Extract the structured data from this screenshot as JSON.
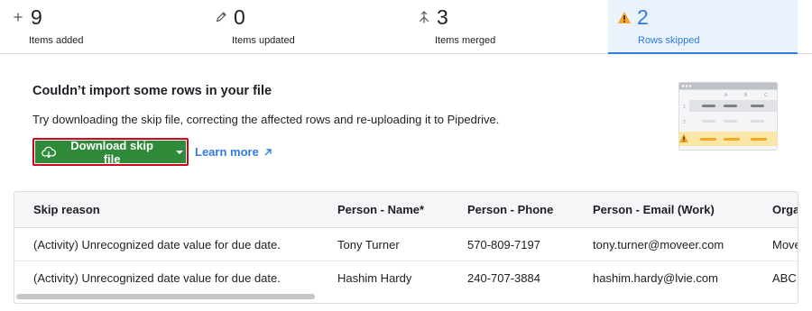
{
  "stats": [
    {
      "icon": "plus-icon",
      "count": "9",
      "label": "Items added",
      "active": false
    },
    {
      "icon": "pencil-icon",
      "count": "0",
      "label": "Items updated",
      "active": false
    },
    {
      "icon": "merge-icon",
      "count": "3",
      "label": "Items merged",
      "active": false
    },
    {
      "icon": "warning-icon",
      "count": "2",
      "label": "Rows skipped",
      "active": true
    }
  ],
  "notice": {
    "title": "Couldn’t import some rows in your file",
    "description": "Try downloading the skip file, correcting the affected rows and re-uploading it to Pipedrive.",
    "download_label": "Download skip file",
    "learn_more_label": "Learn more"
  },
  "illustration": {
    "columns": [
      "A",
      "B",
      "C"
    ],
    "rows": [
      "1",
      "2"
    ]
  },
  "table": {
    "columns": [
      "Skip reason",
      "Person - Name*",
      "Person - Phone",
      "Person - Email (Work)",
      "Orga"
    ],
    "rows": [
      [
        "(Activity) Unrecognized date value for due date.",
        "Tony Turner",
        "570-809-7197",
        "tony.turner@moveer.com",
        "Move"
      ],
      [
        "(Activity) Unrecognized date value for due date.",
        "Hashim Hardy",
        "240-707-3884",
        "hashim.hardy@lvie.com",
        "ABC"
      ]
    ]
  },
  "colors": {
    "accent": "#317ae2",
    "download_button": "#2f8b3a",
    "highlight_border": "#d0021b",
    "warning": "#f5a623"
  }
}
